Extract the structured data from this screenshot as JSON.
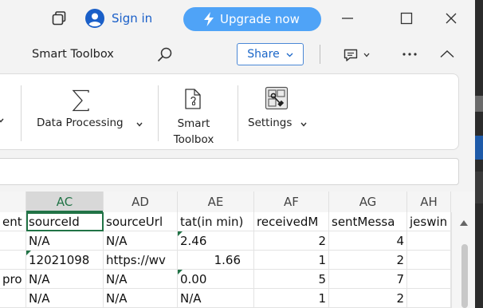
{
  "titlebar": {
    "signin_label": "Sign in",
    "upgrade_label": "Upgrade now",
    "upgrade_color": "#4fa3f7"
  },
  "ribbon_header": {
    "title": "Smart Toolbox",
    "share_label": "Share"
  },
  "ribbon": {
    "data_processing_label": "Data Processing",
    "smart_toolbox_line1": "Smart",
    "smart_toolbox_line2": "Toolbox",
    "settings_label": "Settings"
  },
  "sheet": {
    "accent_color": "#217346",
    "columns": [
      "",
      "AC",
      "AD",
      "AE",
      "AF",
      "AG",
      "AH"
    ],
    "rows": [
      [
        "ent",
        "sourceId",
        "sourceUrl",
        "tat(in min)",
        "receivedM",
        "sentMessa",
        "jeswin"
      ],
      [
        "",
        "N/A",
        "N/A",
        "2.46",
        "2",
        "4",
        ""
      ],
      [
        "",
        "12021098",
        "https://wv",
        "1.66",
        "1",
        "2",
        ""
      ],
      [
        "pro",
        "N/A",
        "N/A",
        "0.00",
        "5",
        "7",
        ""
      ],
      [
        "",
        "N/A",
        "N/A",
        "N/A",
        "1",
        "2",
        ""
      ]
    ]
  }
}
